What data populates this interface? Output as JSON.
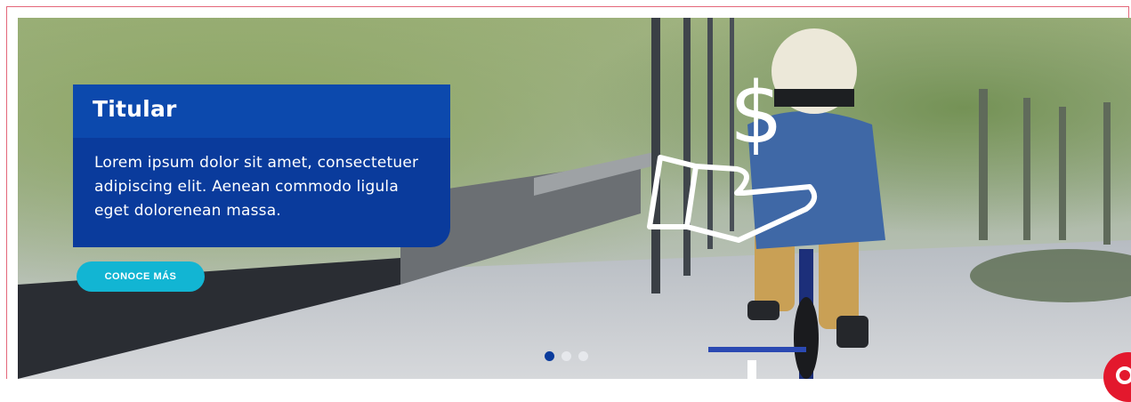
{
  "hero": {
    "title": "Titular",
    "body": "Lorem ipsum dolor sit amet, consectetuer adipiscing elit. Aenean commodo ligula eget dolorenean massa.",
    "cta_label": "CONOCE MÁS",
    "carousel": {
      "slide_count": 3,
      "active_index": 0
    }
  },
  "icons": {
    "overlay": "hand-dollar-icon",
    "chat": "chat-icon"
  },
  "colors": {
    "card_header": "#0c49ad",
    "card_body": "#0a3b9c",
    "cta": "#12b5d3",
    "active_dot": "#0a3b9c",
    "chat": "#e3182d",
    "frame_border": "#e4677a"
  }
}
